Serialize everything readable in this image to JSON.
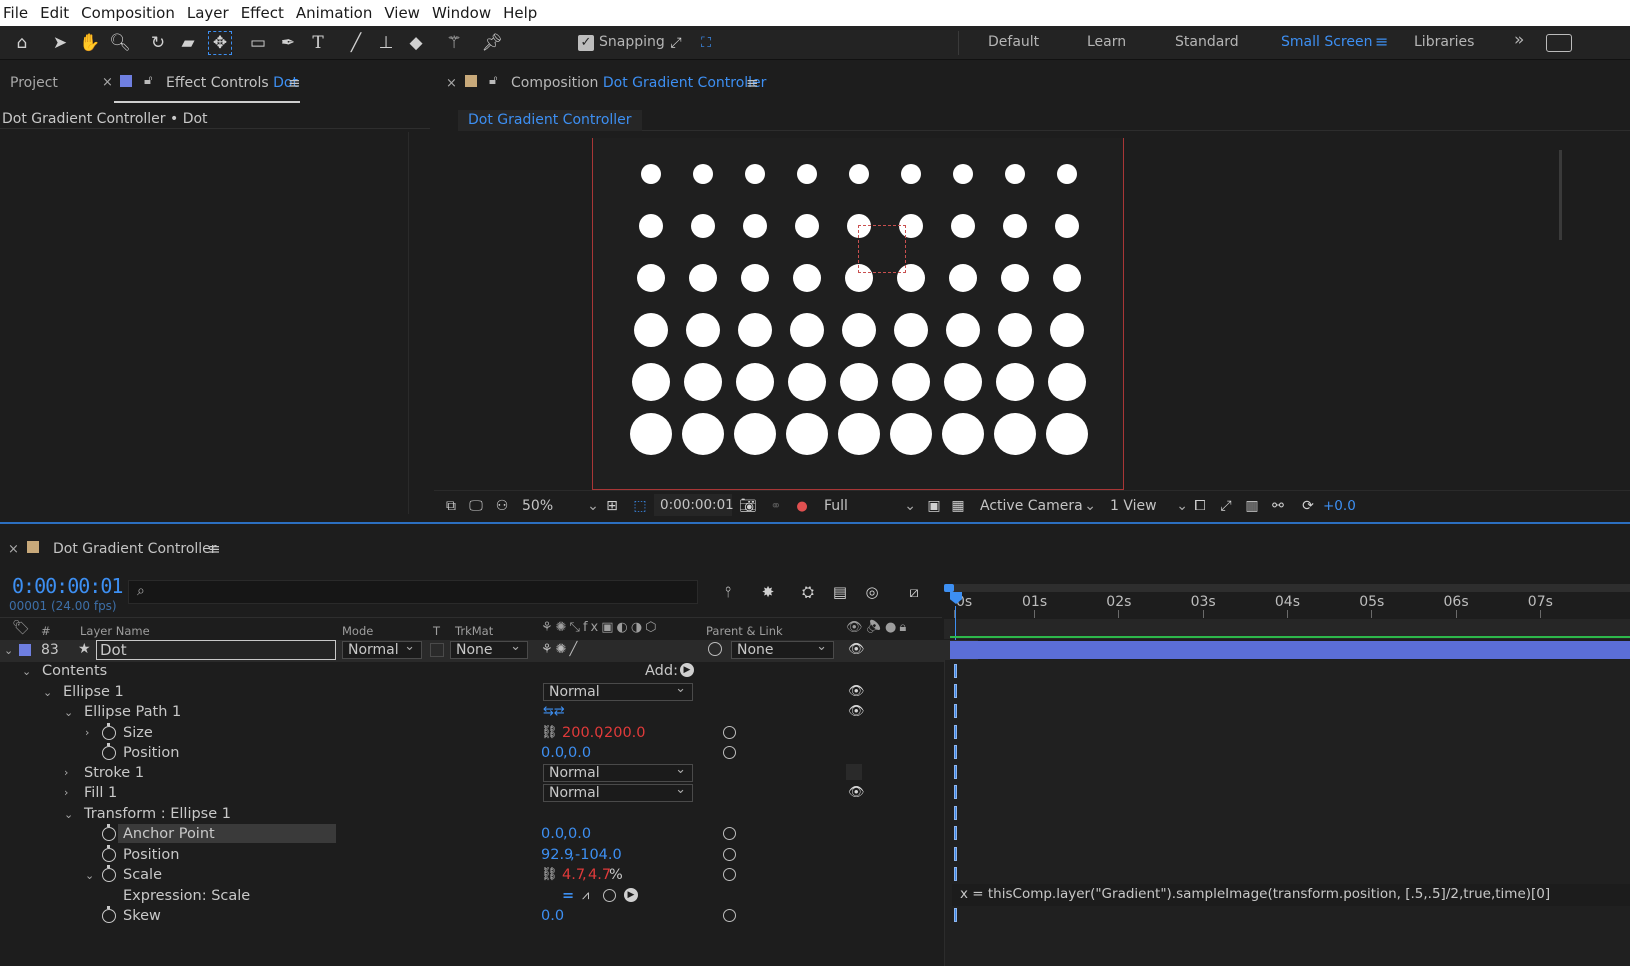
{
  "menu": [
    "File",
    "Edit",
    "Composition",
    "Layer",
    "Effect",
    "Animation",
    "View",
    "Window",
    "Help"
  ],
  "toolbar": {
    "snapping_label": "Snapping",
    "workspaces": [
      "Default",
      "Learn",
      "Standard",
      "Small Screen",
      "Libraries"
    ],
    "active_workspace": "Small Screen",
    "overflow": "»"
  },
  "left_panel": {
    "tab_project": "Project",
    "tab_effect_controls_prefix": "Effect Controls",
    "tab_effect_controls_layer": "Dot",
    "subtitle": "Dot Gradient Controller • Dot"
  },
  "comp_panel": {
    "tab_prefix": "Composition",
    "tab_name": "Dot Gradient Controller",
    "breadcrumb": "Dot Gradient Controller",
    "zoom": "50%",
    "timecode": "0:00:00:01",
    "resolution": "Full",
    "camera": "Active Camera",
    "views": "1 View",
    "exposure": "+0.0",
    "dot_grid": {
      "rows": 6,
      "cols": 9,
      "radius_by_row": [
        10,
        12,
        14,
        17,
        19,
        21
      ]
    }
  },
  "timeline": {
    "tab_name": "Dot Gradient Controller",
    "current_time": "0:00:00:01",
    "frame_info": "00001 (24.00 fps)",
    "search_placeholder": "",
    "columns": {
      "hash": "#",
      "layer_name": "Layer Name",
      "mode": "Mode",
      "t": "T",
      "trkmat": "TrkMat",
      "parent": "Parent & Link"
    },
    "ruler_ticks": [
      "0s",
      "01s",
      "02s",
      "03s",
      "04s",
      "05s",
      "06s",
      "07s"
    ],
    "layer": {
      "index": "83",
      "name": "Dot",
      "mode": "Normal",
      "trkmat": "None",
      "parent": "None"
    },
    "add_label": "Add:",
    "props": {
      "contents": "Contents",
      "ellipse1": "Ellipse 1",
      "ellipse1_mode": "Normal",
      "ellipse_path1": "Ellipse Path 1",
      "size_label": "Size",
      "size_value_a": "200.0",
      "size_value_b": "200.0",
      "position_label": "Position",
      "position_value_a": "0.0",
      "position_value_b": "0.0",
      "stroke1": "Stroke 1",
      "stroke1_mode": "Normal",
      "fill1": "Fill 1",
      "fill1_mode": "Normal",
      "transform_ellipse": "Transform : Ellipse 1",
      "anchor_label": "Anchor Point",
      "anchor_value_a": "0.0",
      "anchor_value_b": "0.0",
      "tpos_label": "Position",
      "tpos_value_a": "92.9",
      "tpos_value_b": "-104.0",
      "scale_label": "Scale",
      "scale_value_a": "4.7",
      "scale_value_b": "4.7",
      "scale_unit": "%",
      "expression_label": "Expression: Scale",
      "skew_label": "Skew",
      "skew_value": "0.0"
    },
    "expression_text": "x  =  thisComp.layer(\"Gradient\").sampleImage(transform.position,  [.5,.5]/2,true,time)[0]"
  },
  "colors": {
    "accent": "#3d8ff2",
    "label_blue": "#6f7fe0",
    "comp_label_tan": "#c8a97a",
    "work_area": "#5b6ed6"
  }
}
